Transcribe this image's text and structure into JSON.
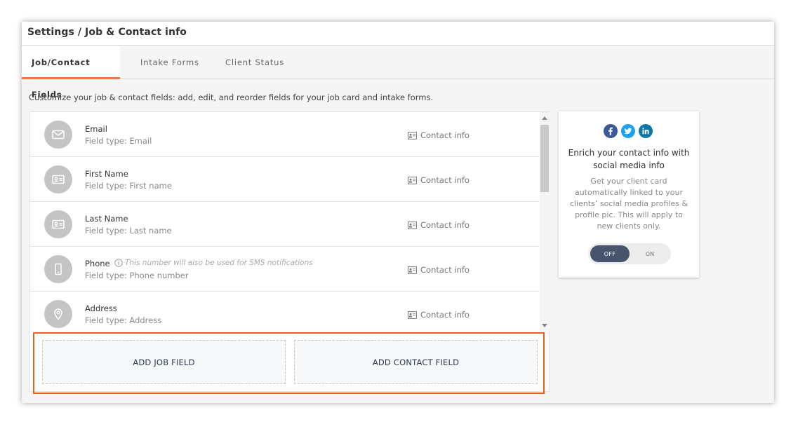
{
  "header": {
    "title": "Settings / Job & Contact info"
  },
  "tabs": [
    {
      "label": "Job/Contact Fields",
      "active": true
    },
    {
      "label": "Intake Forms",
      "active": false
    },
    {
      "label": "Client Status",
      "active": false
    }
  ],
  "description": "Customize your job & contact fields: add, edit, and reorder fields for your job card and intake forms.",
  "fields": [
    {
      "name": "Email",
      "type": "Field type: Email",
      "category": "Contact info",
      "icon": "envelope-icon",
      "note": ""
    },
    {
      "name": "First Name",
      "type": "Field type: First name",
      "category": "Contact info",
      "icon": "id-card-icon",
      "note": ""
    },
    {
      "name": "Last Name",
      "type": "Field type: Last name",
      "category": "Contact info",
      "icon": "id-card-icon",
      "note": ""
    },
    {
      "name": "Phone",
      "type": "Field type: Phone number",
      "category": "Contact info",
      "icon": "mobile-phone-icon",
      "note": "This number will also be used for SMS notifications"
    },
    {
      "name": "Address",
      "type": "Field type: Address",
      "category": "Contact info",
      "icon": "map-pin-icon",
      "note": ""
    }
  ],
  "actions": {
    "add_job_field": "ADD JOB FIELD",
    "add_contact_field": "ADD CONTACT FIELD"
  },
  "social_panel": {
    "icons": [
      "facebook-icon",
      "twitter-icon",
      "linkedin-icon"
    ],
    "heading": "Enrich your contact info with social media info",
    "body": "Get your client card automatically linked to your clients’ social media profiles & profile pic. This will apply to new clients only.",
    "toggle_off": "OFF",
    "toggle_on": "ON",
    "toggle_state": "off"
  },
  "colors": {
    "accent": "#ee7a3c",
    "highlight": "#e8611d",
    "toggle_active": "#47546e",
    "facebook": "#3b5998",
    "twitter": "#1da1f2",
    "linkedin": "#0e76a8"
  }
}
